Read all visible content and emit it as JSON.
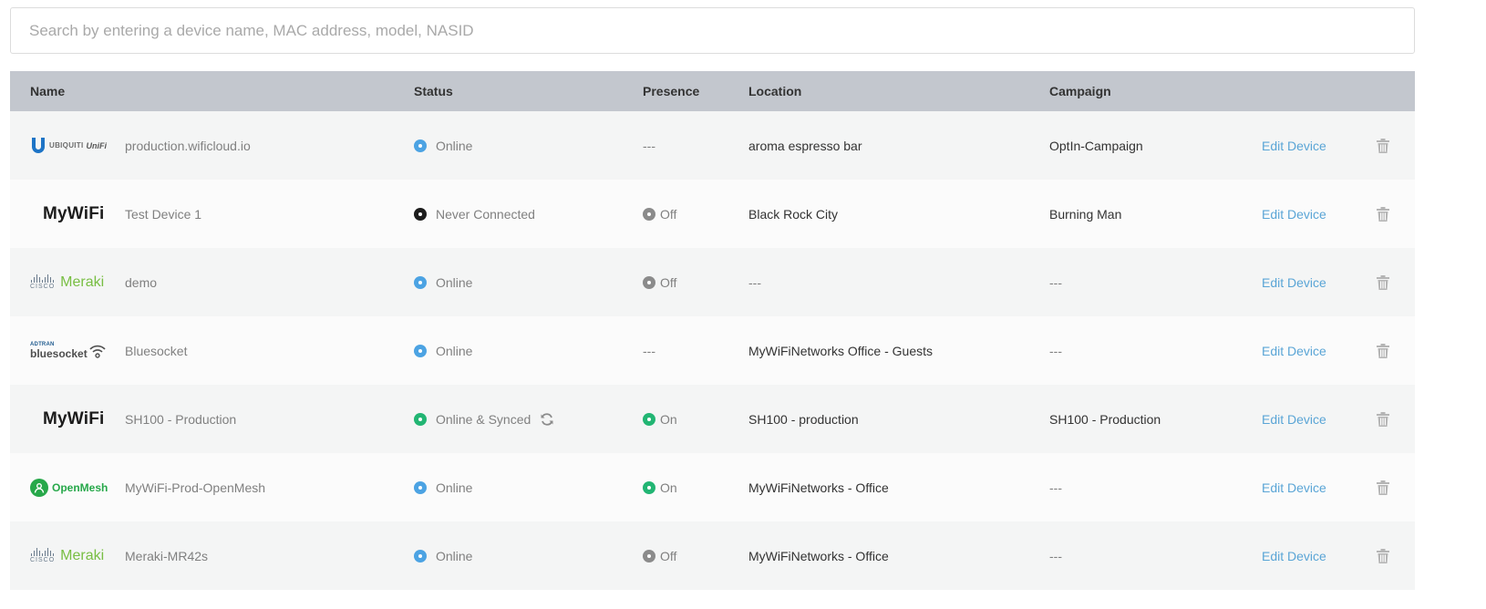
{
  "search": {
    "placeholder": "Search by entering a device name, MAC address, model, NASID"
  },
  "columns": {
    "name": "Name",
    "status": "Status",
    "presence": "Presence",
    "location": "Location",
    "campaign": "Campaign"
  },
  "colors": {
    "online": "#4ca3e3",
    "never_connected": "#1d1d1d",
    "synced": "#22b573",
    "off": "#8b8b8b",
    "link": "#5aa5d6",
    "header_bg": "#c3c7ce"
  },
  "logos": {
    "mywifi": "MyWiFi",
    "meraki_brand": "Meraki",
    "cisco": "CISCO",
    "ubiquiti": "UBIQUITI",
    "unifi": "UniFi",
    "bluesocket": "bluesocket",
    "adtran": "ADTRAN",
    "openmesh": "OpenMesh"
  },
  "rows": [
    {
      "logo": "ubiquiti-logo",
      "name": "production.wificloud.io",
      "status": "Online",
      "status_color": "blue",
      "presence": "---",
      "location": "aroma espresso bar",
      "campaign": "OptIn-Campaign",
      "action": "Edit Device"
    },
    {
      "logo": "mywifi-logo",
      "name": "Test Device 1",
      "status": "Never Connected",
      "status_color": "black",
      "presence": "Off",
      "location": "Black Rock City",
      "campaign": "Burning Man",
      "action": "Edit Device"
    },
    {
      "logo": "meraki-logo",
      "name": "demo",
      "status": "Online",
      "status_color": "blue",
      "presence": "Off",
      "location": "---",
      "campaign": "---",
      "action": "Edit Device"
    },
    {
      "logo": "bluesocket-logo",
      "name": "Bluesocket",
      "status": "Online",
      "status_color": "blue",
      "presence": "---",
      "location": "MyWiFiNetworks Office - Guests",
      "campaign": "---",
      "action": "Edit Device"
    },
    {
      "logo": "mywifi-logo",
      "name": "SH100 - Production",
      "status": "Online & Synced",
      "status_color": "green",
      "presence": "On",
      "location": "SH100 - production",
      "campaign": "SH100 - Production",
      "action": "Edit Device"
    },
    {
      "logo": "openmesh-logo",
      "name": "MyWiFi-Prod-OpenMesh",
      "status": "Online",
      "status_color": "blue",
      "presence": "On",
      "location": "MyWiFiNetworks - Office",
      "campaign": "---",
      "action": "Edit Device"
    },
    {
      "logo": "meraki-logo",
      "name": "Meraki-MR42s",
      "status": "Online",
      "status_color": "blue",
      "presence": "Off",
      "location": "MyWiFiNetworks - Office",
      "campaign": "---",
      "action": "Edit Device"
    }
  ]
}
